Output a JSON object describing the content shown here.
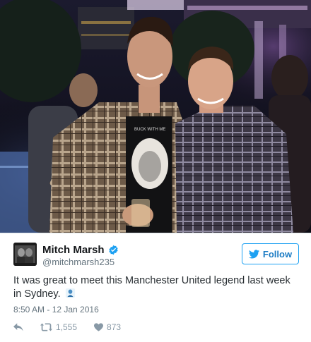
{
  "photo": {
    "shirt_print": "BUCK WITH ME"
  },
  "tweet": {
    "display_name": "Mitch Marsh",
    "handle": "@mitchmarsh235",
    "follow_label": "Follow",
    "text": "It was great to meet this Manchester United legend last week in Sydney.",
    "timestamp": "8:50 AM - 12 Jan 2016",
    "retweet_count": "1,555",
    "like_count": "873"
  },
  "colors": {
    "accent": "#1da1f2",
    "name": "#14171a",
    "meta": "#66757f"
  },
  "icons": [
    "verified-icon",
    "bird-icon",
    "reply-icon",
    "retweet-icon",
    "heart-icon",
    "emoji-icon"
  ]
}
